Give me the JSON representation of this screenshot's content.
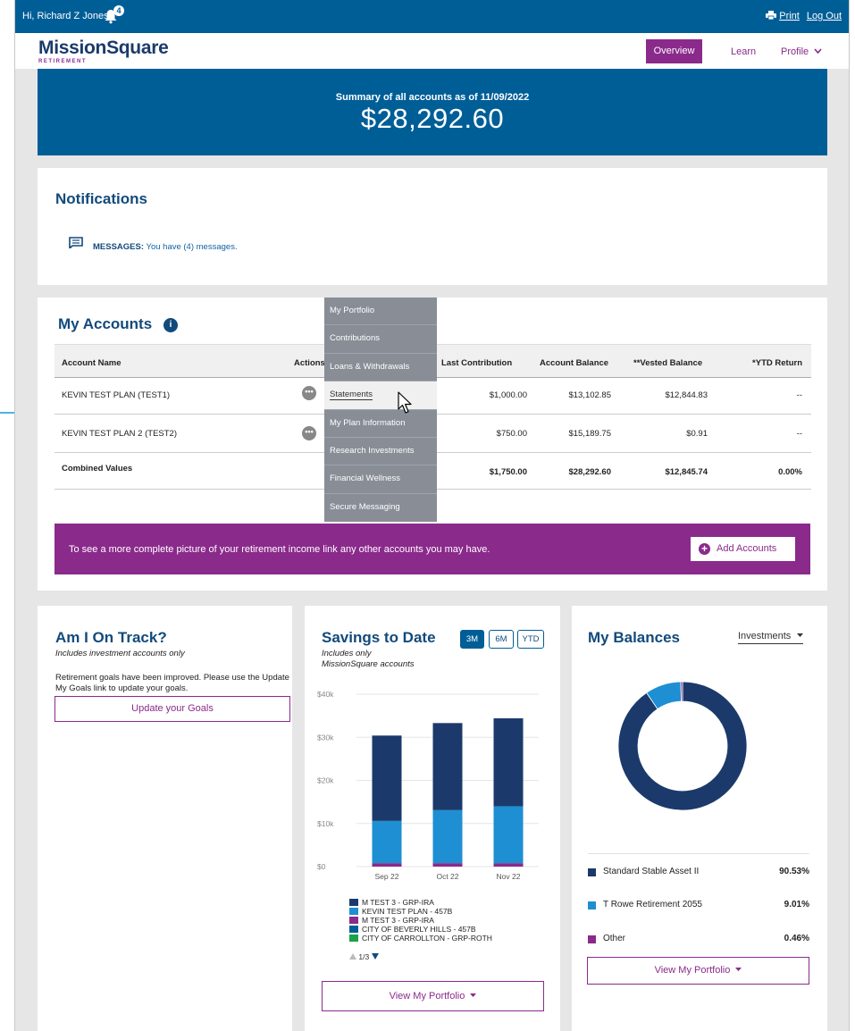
{
  "topbar": {
    "greeting": "Hi, Richard Z Jones",
    "notification_count": "4",
    "print_label": "Print",
    "logout_label": "Log Out"
  },
  "nav": {
    "logo_text": "MissionSquare",
    "logo_sub": "RETIREMENT",
    "overview": "Overview",
    "learn": "Learn",
    "profile": "Profile"
  },
  "summary": {
    "label": "Summary of all accounts as of 11/09/2022",
    "amount": "$28,292.60"
  },
  "notifications": {
    "title": "Notifications",
    "messages_label": "MESSAGES:",
    "messages_text": "You have (4) messages."
  },
  "accounts": {
    "title": "My Accounts",
    "info_glyph": "i",
    "columns": [
      "Account Name",
      "Actions",
      "Last Contribution",
      "Account Balance",
      "**Vested Balance",
      "*YTD Return"
    ],
    "rows": [
      {
        "name": "KEVIN TEST PLAN (TEST1)",
        "last": "$1,000.00",
        "balance": "$13,102.85",
        "vested": "$12,844.83",
        "ytd": "--"
      },
      {
        "name": "KEVIN TEST PLAN 2 (TEST2)",
        "last": "$750.00",
        "balance": "$15,189.75",
        "vested": "$0.91",
        "ytd": "--"
      }
    ],
    "combined": {
      "name": "Combined Values",
      "last": "$1,750.00",
      "balance": "$28,292.60",
      "vested": "$12,845.74",
      "ytd": "0.00%"
    },
    "banner_text": "To see a more complete picture of your retirement income link any other accounts you may have.",
    "add_button": "Add Accounts"
  },
  "actions_menu": {
    "items": [
      "My Portfolio",
      "Contributions",
      "Loans & Withdrawals",
      "Statements",
      "My Plan Information",
      "Research Investments",
      "Financial Wellness",
      "Secure Messaging"
    ],
    "active": "Statements"
  },
  "on_track": {
    "title": "Am I On Track?",
    "subtitle": "Includes investment accounts only",
    "description": "Retirement goals have been improved. Please use the Update My Goals link to update your goals.",
    "button": "Update your Goals"
  },
  "savings": {
    "title": "Savings to Date",
    "subtitle": "Includes only MissionSquare accounts",
    "periods": [
      "3M",
      "6M",
      "YTD"
    ],
    "selected_period": "3M",
    "legend": [
      {
        "label": "M TEST 3 - GRP-IRA",
        "color": "#1b3a6b"
      },
      {
        "label": "KEVIN TEST PLAN - 457B",
        "color": "#1d8fd2"
      },
      {
        "label": "M TEST 3 - GRP-IRA",
        "color": "#8a2a8b"
      },
      {
        "label": "CITY OF BEVERLY HILLS - 457B",
        "color": "#005e97"
      },
      {
        "label": "CITY OF CARROLLTON - GRP-ROTH",
        "color": "#1aa34a"
      }
    ],
    "pager": "1/3",
    "button": "View My Portfolio"
  },
  "balances": {
    "title": "My Balances",
    "selector": "Investments",
    "button": "View My Portfolio",
    "items": [
      {
        "label": "Standard Stable Asset II",
        "pct": "90.53%",
        "value": 90.53,
        "color": "#1b3a6b"
      },
      {
        "label": "T Rowe Retirement 2055",
        "pct": "9.01%",
        "value": 9.01,
        "color": "#1d8fd2"
      },
      {
        "label": "Other",
        "pct": "0.46%",
        "value": 0.46,
        "color": "#8a2a8b"
      }
    ]
  },
  "chart_data": [
    {
      "type": "bar",
      "stacked": true,
      "categories": [
        "Sep 22",
        "Oct 22",
        "Nov 22"
      ],
      "series": [
        {
          "name": "M TEST 3 - GRP-IRA",
          "color": "#8a2a8b",
          "values": [
            800,
            800,
            800
          ]
        },
        {
          "name": "KEVIN TEST PLAN - 457B",
          "color": "#1d8fd2",
          "values": [
            9800,
            12300,
            13200
          ]
        },
        {
          "name": "M TEST 3 - GRP-IRA",
          "color": "#1b3a6b",
          "values": [
            19800,
            20200,
            20400
          ]
        }
      ],
      "yticks": [
        "$0",
        "$10k",
        "$20k",
        "$30k",
        "$40k"
      ],
      "ylim": [
        0,
        40000
      ],
      "grid": true
    },
    {
      "type": "pie",
      "donut": true,
      "labels": [
        "Standard Stable Asset II",
        "T Rowe Retirement 2055",
        "Other"
      ],
      "values": [
        90.53,
        9.01,
        0.46
      ],
      "colors": [
        "#1b3a6b",
        "#1d8fd2",
        "#8a2a8b"
      ]
    }
  ]
}
